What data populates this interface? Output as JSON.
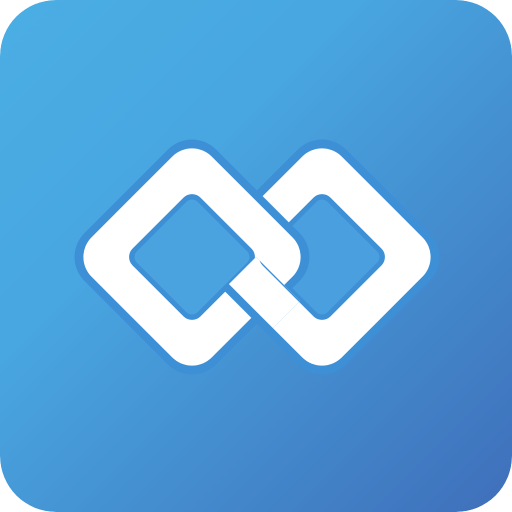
{
  "icon": {
    "name": "linked-rings-app-icon",
    "shape": "rounded-square",
    "glyph": "two-interlocked-rounded-diamond-links",
    "colors": {
      "background_top_left": "#4aaee4",
      "background_bottom_right": "#3f6fba",
      "glyph_fill": "#ffffff",
      "glyph_outline": "#3d8fd6",
      "inner_shadow": "#3c83cc"
    }
  }
}
